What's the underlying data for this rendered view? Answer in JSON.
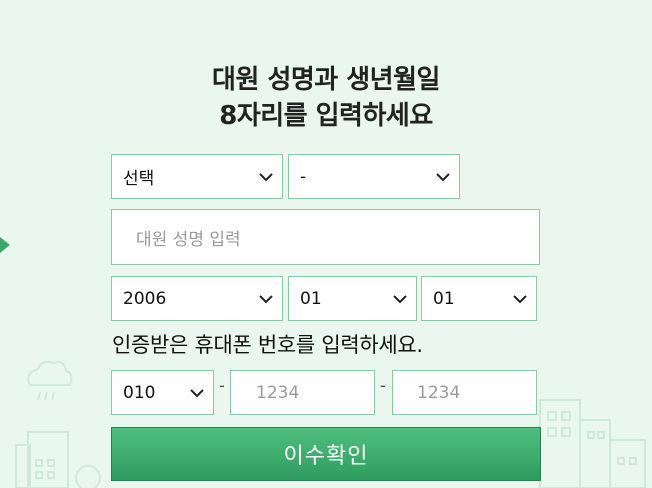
{
  "heading": {
    "line1": "대원 성명과 생년월일",
    "line2": "8자리를 입력하세요"
  },
  "rank_select": {
    "value": "선택"
  },
  "position_select": {
    "value": "-"
  },
  "name_input": {
    "placeholder": "대원 성명 입력"
  },
  "birth": {
    "year": "2006",
    "month": "01",
    "day": "01"
  },
  "phone": {
    "label": "인증받은 휴대폰 번호를 입력하세요.",
    "prefix": "010",
    "middle_placeholder": "1234",
    "last_placeholder": "1234",
    "separator": "-"
  },
  "submit": {
    "label": "이수확인"
  },
  "colors": {
    "background": "#eaf7ef",
    "border": "#8cc9a2",
    "button": "#3aa866"
  }
}
